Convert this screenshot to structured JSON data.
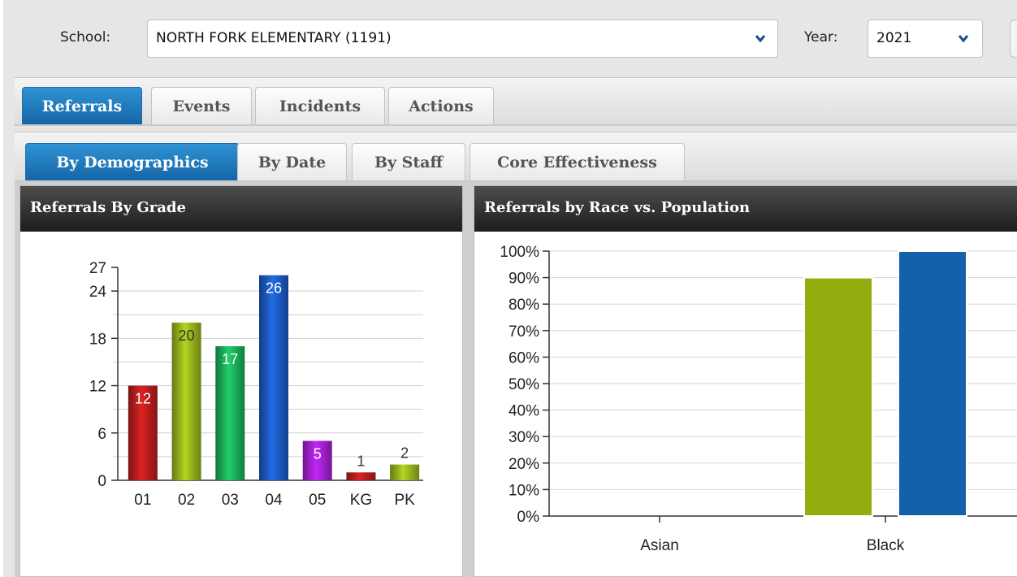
{
  "filters": {
    "school_label": "School:",
    "school_value": "NORTH FORK ELEMENTARY (1191)",
    "year_label": "Year:",
    "year_value": "2021"
  },
  "main_tabs": [
    {
      "label": "Referrals",
      "active": true
    },
    {
      "label": "Events",
      "active": false
    },
    {
      "label": "Incidents",
      "active": false
    },
    {
      "label": "Actions",
      "active": false
    }
  ],
  "sub_tabs": [
    {
      "label": "By Demographics",
      "active": true
    },
    {
      "label": "By Date",
      "active": false
    },
    {
      "label": "By Staff",
      "active": false
    },
    {
      "label": "Core Effectiveness",
      "active": false
    }
  ],
  "panels": {
    "grade_title": "Referrals By Grade",
    "race_title": "Referrals by Race vs. Population"
  },
  "colors": {
    "tab_active": "#1f7bc1",
    "grade_bars": [
      "#b01c1c",
      "#8fab1a",
      "#19a654",
      "#1a56b8",
      "#9b1fc6",
      "#b01c1c",
      "#8fab1a"
    ],
    "race_referrals": "#93ad0f",
    "race_population": "#1560ab"
  },
  "chart_data": [
    {
      "type": "bar",
      "title": "Referrals By Grade",
      "categories": [
        "01",
        "02",
        "03",
        "04",
        "05",
        "KG",
        "PK"
      ],
      "values": [
        12,
        20,
        17,
        26,
        5,
        1,
        2
      ],
      "ylim": [
        0,
        27
      ],
      "yticks": [
        "0",
        "6",
        "12",
        "18",
        "24",
        "27"
      ],
      "data_labels": [
        "12",
        "20",
        "17",
        "26",
        "5",
        "1",
        "2"
      ],
      "grid": true
    },
    {
      "type": "bar",
      "title": "Referrals by Race vs. Population",
      "categories": [
        "Asian",
        "Black"
      ],
      "series": [
        {
          "values": [
            0,
            90
          ]
        },
        {
          "values": [
            0,
            100
          ]
        }
      ],
      "ylim": [
        0,
        100
      ],
      "yticks": [
        "0%",
        "10%",
        "20%",
        "30%",
        "40%",
        "50%",
        "60%",
        "70%",
        "80%",
        "90%",
        "100%"
      ],
      "grid": true
    }
  ]
}
